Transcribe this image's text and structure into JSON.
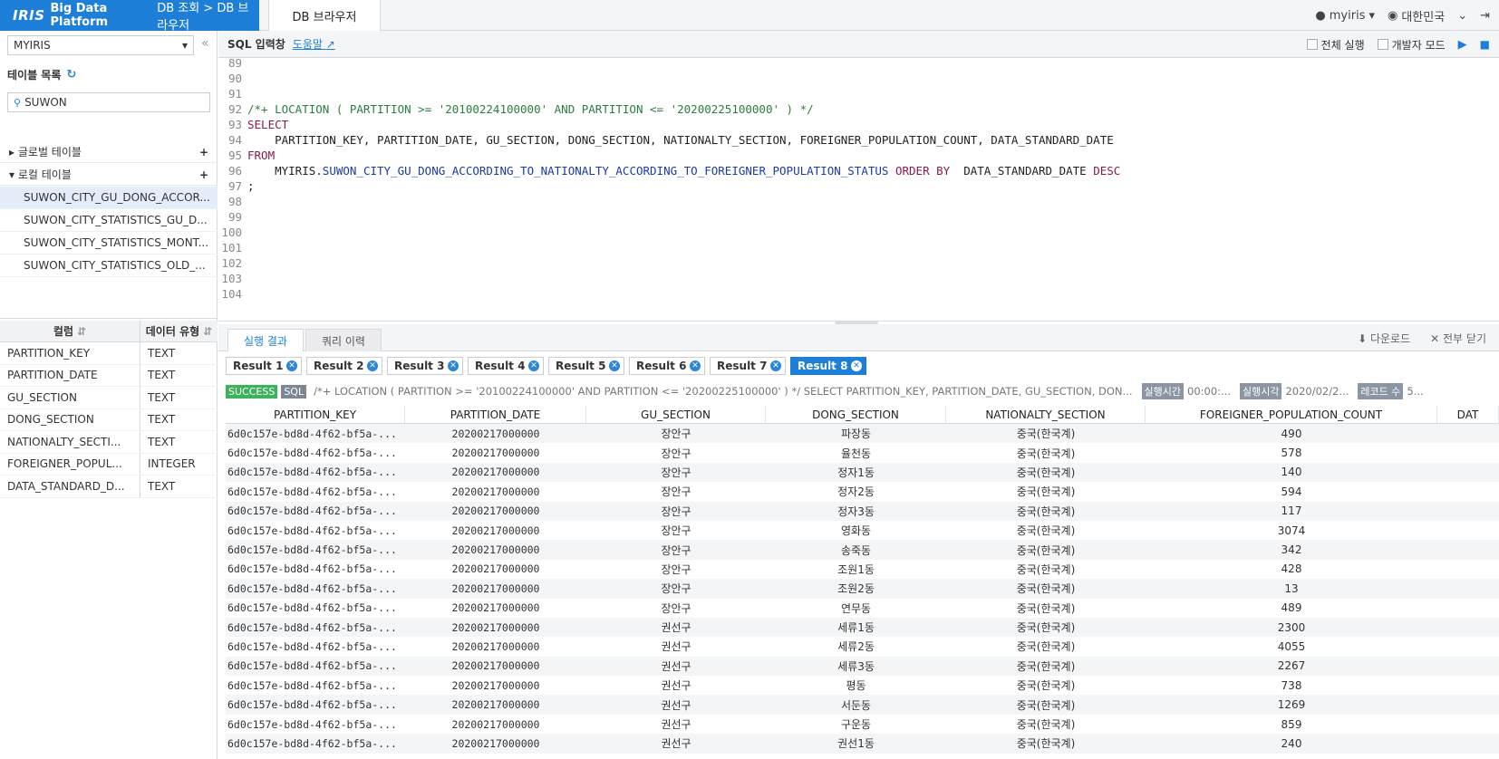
{
  "app": {
    "logo": "IRIS",
    "logo_sub": "Big Data Platform",
    "breadcrumb": "DB 조회 > DB 브라우저",
    "tab": "DB 브라우저",
    "user": "myiris",
    "language": "대한민국"
  },
  "left": {
    "db_selected": "MYIRIS",
    "table_list_label": "테이블 목록",
    "search_value": "SUWON",
    "global_tables": "글로벌 테이블",
    "local_tables": "로컬 테이블",
    "tables": [
      "SUWON_CITY_GU_DONG_ACCOR...",
      "SUWON_CITY_STATISTICS_GU_D...",
      "SUWON_CITY_STATISTICS_MONT...",
      "SUWON_CITY_STATISTICS_OLD_..."
    ],
    "col_header": "컬럼",
    "type_header": "데이터 유형",
    "columns": [
      {
        "name": "PARTITION_KEY",
        "type": "TEXT"
      },
      {
        "name": "PARTITION_DATE",
        "type": "TEXT"
      },
      {
        "name": "GU_SECTION",
        "type": "TEXT"
      },
      {
        "name": "DONG_SECTION",
        "type": "TEXT"
      },
      {
        "name": "NATIONALTY_SECTI...",
        "type": "TEXT"
      },
      {
        "name": "FOREIGNER_POPUL...",
        "type": "INTEGER"
      },
      {
        "name": "DATA_STANDARD_D...",
        "type": "TEXT"
      }
    ]
  },
  "sql": {
    "title": "SQL 입력창",
    "help": "도움말",
    "run_all": "전체 실행",
    "dev_mode": "개발자 모드",
    "line_numbers": [
      "89",
      "90",
      "91",
      "92",
      "93",
      "94",
      "95",
      "96",
      "97",
      "98",
      "99",
      "100",
      "101",
      "102",
      "103",
      "104"
    ],
    "comment_line": "/*+ LOCATION ( PARTITION >= '20100224100000' AND PARTITION <= '20200225100000' ) */",
    "select_kw": "SELECT",
    "select_cols": "    PARTITION_KEY, PARTITION_DATE, GU_SECTION, DONG_SECTION, NATIONALTY_SECTION, FOREIGNER_POPULATION_COUNT, DATA_STANDARD_DATE",
    "from_kw": "FROM",
    "schema": "    MYIRIS.",
    "table": "SUWON_CITY_GU_DONG_ACCORDING_TO_NATIONALTY_ACCORDING_TO_FOREIGNER_POPULATION_STATUS",
    "order_kw": " ORDER BY ",
    "order_col": " DATA_STANDARD_DATE ",
    "desc_kw": "DESC",
    "semicolon": ";"
  },
  "results": {
    "tab_result": "실행 결과",
    "tab_history": "쿼리 이력",
    "download": "다운로드",
    "close_all": "전부 닫기",
    "chips": [
      "Result 1",
      "Result 2",
      "Result 3",
      "Result 4",
      "Result 5",
      "Result 6",
      "Result 7",
      "Result 8"
    ],
    "status": "SUCCESS",
    "sql_badge": "SQL",
    "query_text": "/*+ LOCATION ( PARTITION >= '20100224100000' AND PARTITION <= '20200225100000' ) */ SELECT PARTITION_KEY, PARTITION_DATE, GU_SECTION, DON...",
    "exec_time_label": "실행시간",
    "exec_time": "00:00:...",
    "exec_at_label": "실행시각",
    "exec_at": "2020/02/2...",
    "record_label": "레코드 수",
    "record_count": "5...",
    "headers": [
      "PARTITION_KEY",
      "PARTITION_DATE",
      "GU_SECTION",
      "DONG_SECTION",
      "NATIONALTY_SECTION",
      "FOREIGNER_POPULATION_COUNT",
      "DAT"
    ],
    "rows": [
      [
        "6d0c157e-bd8d-4f62-bf5a-...",
        "20200217000000",
        "장안구",
        "파장동",
        "중국(한국계)",
        "490"
      ],
      [
        "6d0c157e-bd8d-4f62-bf5a-...",
        "20200217000000",
        "장안구",
        "율천동",
        "중국(한국계)",
        "578"
      ],
      [
        "6d0c157e-bd8d-4f62-bf5a-...",
        "20200217000000",
        "장안구",
        "정자1동",
        "중국(한국계)",
        "140"
      ],
      [
        "6d0c157e-bd8d-4f62-bf5a-...",
        "20200217000000",
        "장안구",
        "정자2동",
        "중국(한국계)",
        "594"
      ],
      [
        "6d0c157e-bd8d-4f62-bf5a-...",
        "20200217000000",
        "장안구",
        "정자3동",
        "중국(한국계)",
        "117"
      ],
      [
        "6d0c157e-bd8d-4f62-bf5a-...",
        "20200217000000",
        "장안구",
        "영화동",
        "중국(한국계)",
        "3074"
      ],
      [
        "6d0c157e-bd8d-4f62-bf5a-...",
        "20200217000000",
        "장안구",
        "송죽동",
        "중국(한국계)",
        "342"
      ],
      [
        "6d0c157e-bd8d-4f62-bf5a-...",
        "20200217000000",
        "장안구",
        "조원1동",
        "중국(한국계)",
        "428"
      ],
      [
        "6d0c157e-bd8d-4f62-bf5a-...",
        "20200217000000",
        "장안구",
        "조원2동",
        "중국(한국계)",
        "13"
      ],
      [
        "6d0c157e-bd8d-4f62-bf5a-...",
        "20200217000000",
        "장안구",
        "연무동",
        "중국(한국계)",
        "489"
      ],
      [
        "6d0c157e-bd8d-4f62-bf5a-...",
        "20200217000000",
        "권선구",
        "세류1동",
        "중국(한국계)",
        "2300"
      ],
      [
        "6d0c157e-bd8d-4f62-bf5a-...",
        "20200217000000",
        "권선구",
        "세류2동",
        "중국(한국계)",
        "4055"
      ],
      [
        "6d0c157e-bd8d-4f62-bf5a-...",
        "20200217000000",
        "권선구",
        "세류3동",
        "중국(한국계)",
        "2267"
      ],
      [
        "6d0c157e-bd8d-4f62-bf5a-...",
        "20200217000000",
        "권선구",
        "평동",
        "중국(한국계)",
        "738"
      ],
      [
        "6d0c157e-bd8d-4f62-bf5a-...",
        "20200217000000",
        "권선구",
        "서둔동",
        "중국(한국계)",
        "1269"
      ],
      [
        "6d0c157e-bd8d-4f62-bf5a-...",
        "20200217000000",
        "권선구",
        "구운동",
        "중국(한국계)",
        "859"
      ],
      [
        "6d0c157e-bd8d-4f62-bf5a-...",
        "20200217000000",
        "권선구",
        "권선1동",
        "중국(한국계)",
        "240"
      ]
    ]
  }
}
